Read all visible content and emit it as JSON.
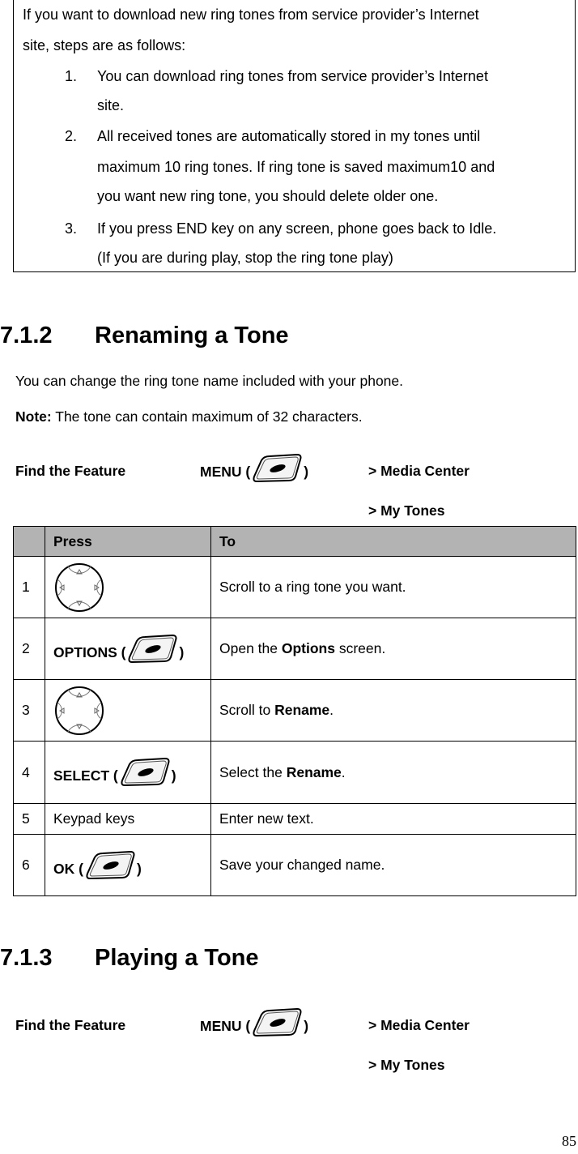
{
  "intro_box": {
    "line1": "If you want to download new ring tones from service provider’s Internet",
    "line2": "site, steps are as follows:",
    "steps": [
      {
        "num": "1.",
        "lines": [
          "You can download ring tones from service provider’s Internet",
          "site."
        ]
      },
      {
        "num": "2.",
        "lines": [
          "All received tones are automatically stored in my tones until",
          "maximum 10 ring tones. If ring tone is saved maximum10 and",
          "you want new ring tone, you should delete older one."
        ]
      },
      {
        "num": "3.",
        "lines": [
          "If you press END key on any screen, phone goes back to Idle.",
          "(If you are during play, stop the ring tone play)"
        ]
      }
    ]
  },
  "section_712": {
    "number": "7.1.2",
    "title": "Renaming a Tone",
    "description": "You can change the ring tone name included with your phone.",
    "note_label": "Note:",
    "note_text": " The tone can contain maximum of 32 characters.",
    "find_feature": {
      "label": "Find the Feature",
      "menu_label": "MENU (",
      "menu_close": ")",
      "menu_icon": "soft-key-icon",
      "path": [
        "> Media Center",
        "> My Tones"
      ]
    },
    "table": {
      "headers": [
        "",
        "Press",
        "To"
      ],
      "rows": [
        {
          "num": "1",
          "press_icon": "navigation-key-icon",
          "press_text": "",
          "to_pre": "Scroll to a ring tone you want.",
          "to_bold": "",
          "to_post": ""
        },
        {
          "num": "2",
          "press_icon": "soft-key-icon",
          "press_text": "OPTIONS (",
          "press_close": ")",
          "to_pre": "Open the ",
          "to_bold": "Options",
          "to_post": " screen."
        },
        {
          "num": "3",
          "press_icon": "navigation-key-icon",
          "press_text": "",
          "to_pre": "Scroll to ",
          "to_bold": "Rename",
          "to_post": "."
        },
        {
          "num": "4",
          "press_icon": "soft-key-icon",
          "press_text": "SELECT (",
          "press_close": ")",
          "to_pre": "Select the ",
          "to_bold": "Rename",
          "to_post": "."
        },
        {
          "num": "5",
          "press_icon": "",
          "press_text": "Keypad keys",
          "to_pre": "Enter new text.",
          "to_bold": "",
          "to_post": ""
        },
        {
          "num": "6",
          "press_icon": "soft-key-icon",
          "press_text": "OK (",
          "press_close": ")",
          "to_pre": "Save your changed name.",
          "to_bold": "",
          "to_post": ""
        }
      ]
    }
  },
  "section_713": {
    "number": "7.1.3",
    "title": "Playing a Tone",
    "find_feature": {
      "label": "Find the Feature",
      "menu_label": "MENU (",
      "menu_close": ")",
      "menu_icon": "soft-key-icon",
      "path": [
        "> Media Center",
        "> My Tones"
      ]
    }
  },
  "page_number": "85",
  "colors": {
    "table_header_bg": "#b3b3b3",
    "border": "#000000"
  }
}
